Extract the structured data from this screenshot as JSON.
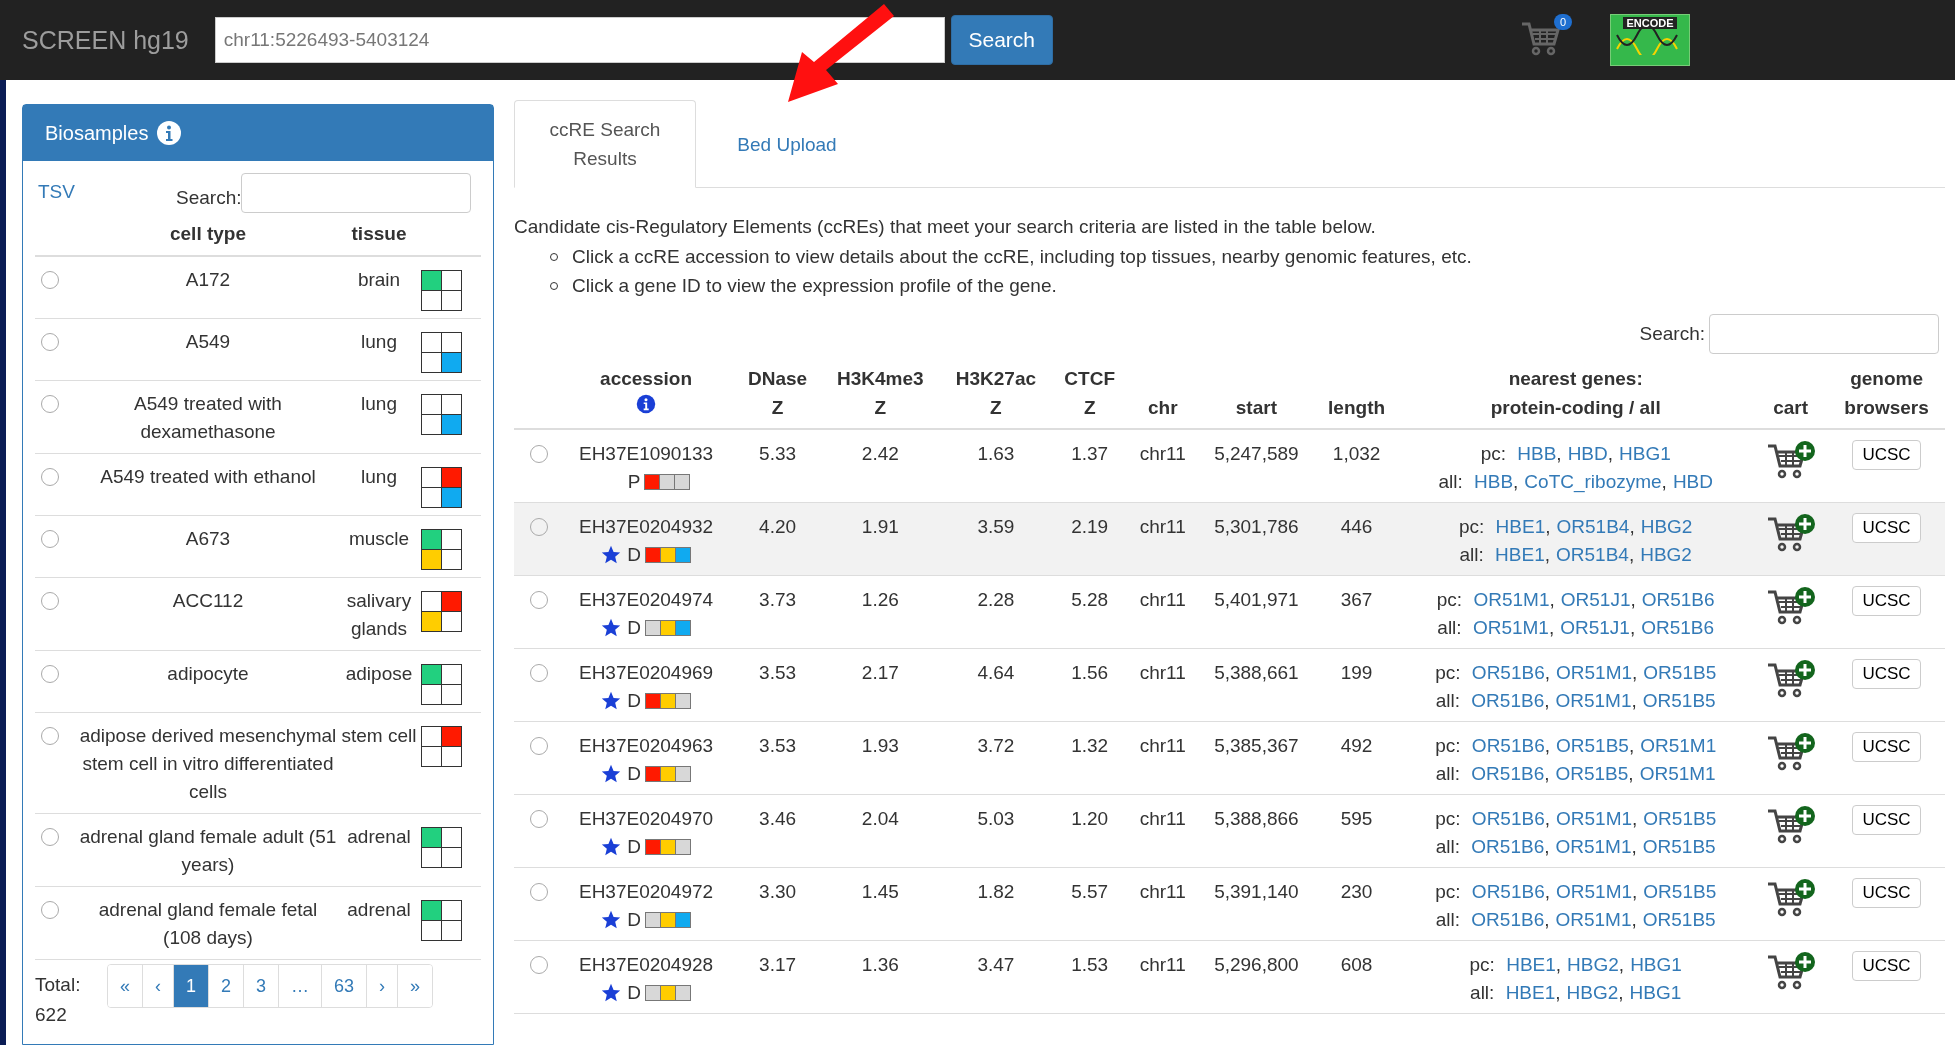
{
  "top_bar": {
    "brand": "SCREEN hg19",
    "search_value": "chr11:5226493-5403124",
    "search_button": "Search",
    "cart_count": "0",
    "logo_text": "ENCODE"
  },
  "biosamples": {
    "title": "Biosamples",
    "tsv_link": "TSV",
    "search_label": "Search:",
    "columns": [
      "cell type",
      "tissue"
    ],
    "rows": [
      {
        "cell_type": "A172",
        "tissue": "brain",
        "selected": false,
        "cells": [
          {
            "color": "#22d07f"
          },
          {
            "color": "#ffffff"
          },
          {
            "color": "#ffffff"
          },
          {
            "color": "#ffffff"
          }
        ]
      },
      {
        "cell_type": "A549",
        "tissue": "lung",
        "selected": false,
        "cells": [
          {
            "color": "#ffffff"
          },
          {
            "color": "#ffffff"
          },
          {
            "color": "#ffffff"
          },
          {
            "color": "#10aaf0"
          }
        ]
      },
      {
        "cell_type": "A549 treated with dexamethasone",
        "tissue": "lung",
        "selected": false,
        "cells": [
          {
            "color": "#ffffff"
          },
          {
            "color": "#ffffff"
          },
          {
            "color": "#ffffff"
          },
          {
            "color": "#10aaf0"
          }
        ]
      },
      {
        "cell_type": "A549 treated with ethanol",
        "tissue": "lung",
        "selected": false,
        "cells": [
          {
            "color": "#ffffff"
          },
          {
            "color": "#ff1a00"
          },
          {
            "color": "#ffffff"
          },
          {
            "color": "#10aaf0"
          }
        ]
      },
      {
        "cell_type": "A673",
        "tissue": "muscle",
        "selected": false,
        "cells": [
          {
            "color": "#22d07f"
          },
          {
            "color": "#ffffff"
          },
          {
            "color": "#ffcd00"
          },
          {
            "color": "#ffffff"
          }
        ]
      },
      {
        "cell_type": "ACC112",
        "tissue": "salivary glands",
        "selected": false,
        "cells": [
          {
            "color": "#ffffff"
          },
          {
            "color": "#ff1a00"
          },
          {
            "color": "#ffcd00"
          },
          {
            "color": "#ffffff"
          }
        ]
      },
      {
        "cell_type": "adipocyte",
        "tissue": "adipose",
        "selected": false,
        "cells": [
          {
            "color": "#22d07f"
          },
          {
            "color": "#ffffff"
          },
          {
            "color": "#ffffff"
          },
          {
            "color": "#ffffff"
          }
        ]
      },
      {
        "cell_type": "adipose derived mesenchymal stem cell in vitro differentiated cells",
        "tissue": "stem cell",
        "selected": false,
        "cells": [
          {
            "color": "#ffffff"
          },
          {
            "color": "#ff1a00"
          },
          {
            "color": "#ffffff"
          },
          {
            "color": "#ffffff"
          }
        ]
      },
      {
        "cell_type": "adrenal gland female adult (51 years)",
        "tissue": "adrenal",
        "selected": false,
        "cells": [
          {
            "color": "#22d07f"
          },
          {
            "color": "#ffffff"
          },
          {
            "color": "#ffffff"
          },
          {
            "color": "#ffffff"
          }
        ]
      },
      {
        "cell_type": "adrenal gland female fetal (108 days)",
        "tissue": "adrenal",
        "selected": false,
        "cells": [
          {
            "color": "#22d07f"
          },
          {
            "color": "#ffffff"
          },
          {
            "color": "#ffffff"
          },
          {
            "color": "#ffffff"
          }
        ]
      }
    ],
    "total": "Total: 622",
    "pages": [
      {
        "label": "«",
        "selected": false
      },
      {
        "label": "‹",
        "selected": false
      },
      {
        "label": "1",
        "selected": true
      },
      {
        "label": "2",
        "selected": false
      },
      {
        "label": "3",
        "selected": false
      },
      {
        "label": "…",
        "selected": false
      },
      {
        "label": "63",
        "selected": false
      },
      {
        "label": "›",
        "selected": false
      },
      {
        "label": "»",
        "selected": false
      }
    ]
  },
  "tabs": [
    {
      "label": "ccRE Search Results",
      "selected": true
    },
    {
      "label": "Bed Upload",
      "selected": false
    }
  ],
  "intro": "Candidate cis-Regulatory Elements (ccREs) that meet your search criteria are listed in the table below.",
  "bullets": [
    "Click a ccRE accession to view details about the ccRE, including top tissues, nearby genomic features, etc.",
    "Click a gene ID to view the expression profile of the gene."
  ],
  "table_search_label": "Search:",
  "gene_separator": ",",
  "columns": [
    [
      "accession"
    ],
    [
      "DNase",
      "Z"
    ],
    [
      "H3K4me3",
      "Z"
    ],
    [
      "H3K27ac",
      "Z"
    ],
    [
      "CTCF",
      "Z"
    ],
    [
      "chr"
    ],
    [
      "start"
    ],
    [
      "length"
    ],
    [
      "nearest genes:",
      "protein-coding / all"
    ],
    [
      "cart"
    ],
    [
      "genome",
      "browsers"
    ]
  ],
  "rows": [
    {
      "accession": "EH37E1090133",
      "star": false,
      "group": "P",
      "boxes": [
        {
          "color": "#ff1a00"
        },
        {
          "color": "#d8d8d8"
        },
        {
          "color": "#d8d8d8"
        }
      ],
      "dnase": "5.33",
      "h3k4me3": "2.42",
      "h3k27ac": "1.63",
      "ctcf": "1.37",
      "chr": "chr11",
      "start": "5,247,589",
      "length": "1,032",
      "selected": false,
      "highlighted": false,
      "genes": [
        {
          "label": "pc:",
          "links": [
            "HBB",
            "HBD",
            "HBG1"
          ]
        },
        {
          "label": "all:",
          "links": [
            "HBB",
            "CoTC_ribozyme",
            "HBD"
          ]
        }
      ],
      "browser": "UCSC"
    },
    {
      "accession": "EH37E0204932",
      "star": true,
      "group": "D",
      "boxes": [
        {
          "color": "#ff1a00"
        },
        {
          "color": "#ffcd00"
        },
        {
          "color": "#10aaf0"
        }
      ],
      "dnase": "4.20",
      "h3k4me3": "1.91",
      "h3k27ac": "3.59",
      "ctcf": "2.19",
      "chr": "chr11",
      "start": "5,301,786",
      "length": "446",
      "selected": false,
      "highlighted": true,
      "genes": [
        {
          "label": "pc:",
          "links": [
            "HBE1",
            "OR51B4",
            "HBG2"
          ]
        },
        {
          "label": "all:",
          "links": [
            "HBE1",
            "OR51B4",
            "HBG2"
          ]
        }
      ],
      "browser": "UCSC"
    },
    {
      "accession": "EH37E0204974",
      "star": true,
      "group": "D",
      "boxes": [
        {
          "color": "#d8d8d8"
        },
        {
          "color": "#ffcd00"
        },
        {
          "color": "#10aaf0"
        }
      ],
      "dnase": "3.73",
      "h3k4me3": "1.26",
      "h3k27ac": "2.28",
      "ctcf": "5.28",
      "chr": "chr11",
      "start": "5,401,971",
      "length": "367",
      "selected": false,
      "highlighted": false,
      "genes": [
        {
          "label": "pc:",
          "links": [
            "OR51M1",
            "OR51J1",
            "OR51B6"
          ]
        },
        {
          "label": "all:",
          "links": [
            "OR51M1",
            "OR51J1",
            "OR51B6"
          ]
        }
      ],
      "browser": "UCSC"
    },
    {
      "accession": "EH37E0204969",
      "star": true,
      "group": "D",
      "boxes": [
        {
          "color": "#ff1a00"
        },
        {
          "color": "#ffcd00"
        },
        {
          "color": "#d8d8d8"
        }
      ],
      "dnase": "3.53",
      "h3k4me3": "2.17",
      "h3k27ac": "4.64",
      "ctcf": "1.56",
      "chr": "chr11",
      "start": "5,388,661",
      "length": "199",
      "selected": false,
      "highlighted": false,
      "genes": [
        {
          "label": "pc:",
          "links": [
            "OR51B6",
            "OR51M1",
            "OR51B5"
          ]
        },
        {
          "label": "all:",
          "links": [
            "OR51B6",
            "OR51M1",
            "OR51B5"
          ]
        }
      ],
      "browser": "UCSC"
    },
    {
      "accession": "EH37E0204963",
      "star": true,
      "group": "D",
      "boxes": [
        {
          "color": "#ff1a00"
        },
        {
          "color": "#ffcd00"
        },
        {
          "color": "#d8d8d8"
        }
      ],
      "dnase": "3.53",
      "h3k4me3": "1.93",
      "h3k27ac": "3.72",
      "ctcf": "1.32",
      "chr": "chr11",
      "start": "5,385,367",
      "length": "492",
      "selected": false,
      "highlighted": false,
      "genes": [
        {
          "label": "pc:",
          "links": [
            "OR51B6",
            "OR51B5",
            "OR51M1"
          ]
        },
        {
          "label": "all:",
          "links": [
            "OR51B6",
            "OR51B5",
            "OR51M1"
          ]
        }
      ],
      "browser": "UCSC"
    },
    {
      "accession": "EH37E0204970",
      "star": true,
      "group": "D",
      "boxes": [
        {
          "color": "#ff1a00"
        },
        {
          "color": "#ffcd00"
        },
        {
          "color": "#d8d8d8"
        }
      ],
      "dnase": "3.46",
      "h3k4me3": "2.04",
      "h3k27ac": "5.03",
      "ctcf": "1.20",
      "chr": "chr11",
      "start": "5,388,866",
      "length": "595",
      "selected": false,
      "highlighted": false,
      "genes": [
        {
          "label": "pc:",
          "links": [
            "OR51B6",
            "OR51M1",
            "OR51B5"
          ]
        },
        {
          "label": "all:",
          "links": [
            "OR51B6",
            "OR51M1",
            "OR51B5"
          ]
        }
      ],
      "browser": "UCSC"
    },
    {
      "accession": "EH37E0204972",
      "star": true,
      "group": "D",
      "boxes": [
        {
          "color": "#d8d8d8"
        },
        {
          "color": "#ffcd00"
        },
        {
          "color": "#10aaf0"
        }
      ],
      "dnase": "3.30",
      "h3k4me3": "1.45",
      "h3k27ac": "1.82",
      "ctcf": "5.57",
      "chr": "chr11",
      "start": "5,391,140",
      "length": "230",
      "selected": false,
      "highlighted": false,
      "genes": [
        {
          "label": "pc:",
          "links": [
            "OR51B6",
            "OR51M1",
            "OR51B5"
          ]
        },
        {
          "label": "all:",
          "links": [
            "OR51B6",
            "OR51M1",
            "OR51B5"
          ]
        }
      ],
      "browser": "UCSC"
    },
    {
      "accession": "EH37E0204928",
      "star": true,
      "group": "D",
      "boxes": [
        {
          "color": "#d8d8d8"
        },
        {
          "color": "#ffcd00"
        },
        {
          "color": "#d8d8d8"
        }
      ],
      "dnase": "3.17",
      "h3k4me3": "1.36",
      "h3k27ac": "3.47",
      "ctcf": "1.53",
      "chr": "chr11",
      "start": "5,296,800",
      "length": "608",
      "selected": false,
      "highlighted": false,
      "genes": [
        {
          "label": "pc:",
          "links": [
            "HBE1",
            "HBG2",
            "HBG1"
          ]
        },
        {
          "label": "all:",
          "links": [
            "HBE1",
            "HBG2",
            "HBG1"
          ]
        }
      ],
      "browser": "UCSC"
    }
  ]
}
